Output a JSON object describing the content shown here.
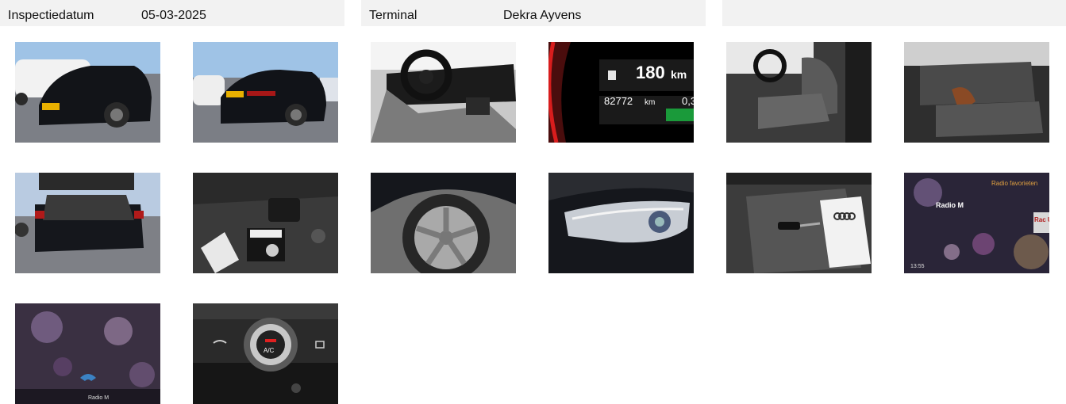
{
  "header": {
    "inspection_label": "Inspectiedatum",
    "inspection_date": "05-03-2025",
    "terminal_label": "Terminal",
    "terminal_value": "Dekra Ayvens"
  },
  "photos": [
    {
      "name": "front-left-exterior-photo"
    },
    {
      "name": "rear-right-exterior-photo"
    },
    {
      "name": "dashboard-steering-photo",
      "texts": {}
    },
    {
      "name": "odometer-photo",
      "texts": {
        "range": "180",
        "range_unit": "km",
        "odometer": "82772",
        "odometer_unit": "km",
        "fraction": "0,3"
      }
    },
    {
      "name": "front-seats-photo"
    },
    {
      "name": "rear-seats-photo"
    },
    {
      "name": "open-trunk-photo"
    },
    {
      "name": "trunk-tire-repair-kit-photo"
    },
    {
      "name": "wheel-tire-photo"
    },
    {
      "name": "headlight-photo"
    },
    {
      "name": "key-and-manual-photo"
    },
    {
      "name": "infotainment-radio-photo",
      "texts": {
        "favorites": "Radio favorieten",
        "station": "Radio M",
        "side": "Rac Utr",
        "time": "13:55"
      }
    },
    {
      "name": "infotainment-screen-photo",
      "texts": {
        "bottom": "Radio M"
      }
    },
    {
      "name": "climate-control-ac-photo",
      "texts": {
        "ac": "A/C"
      }
    }
  ]
}
